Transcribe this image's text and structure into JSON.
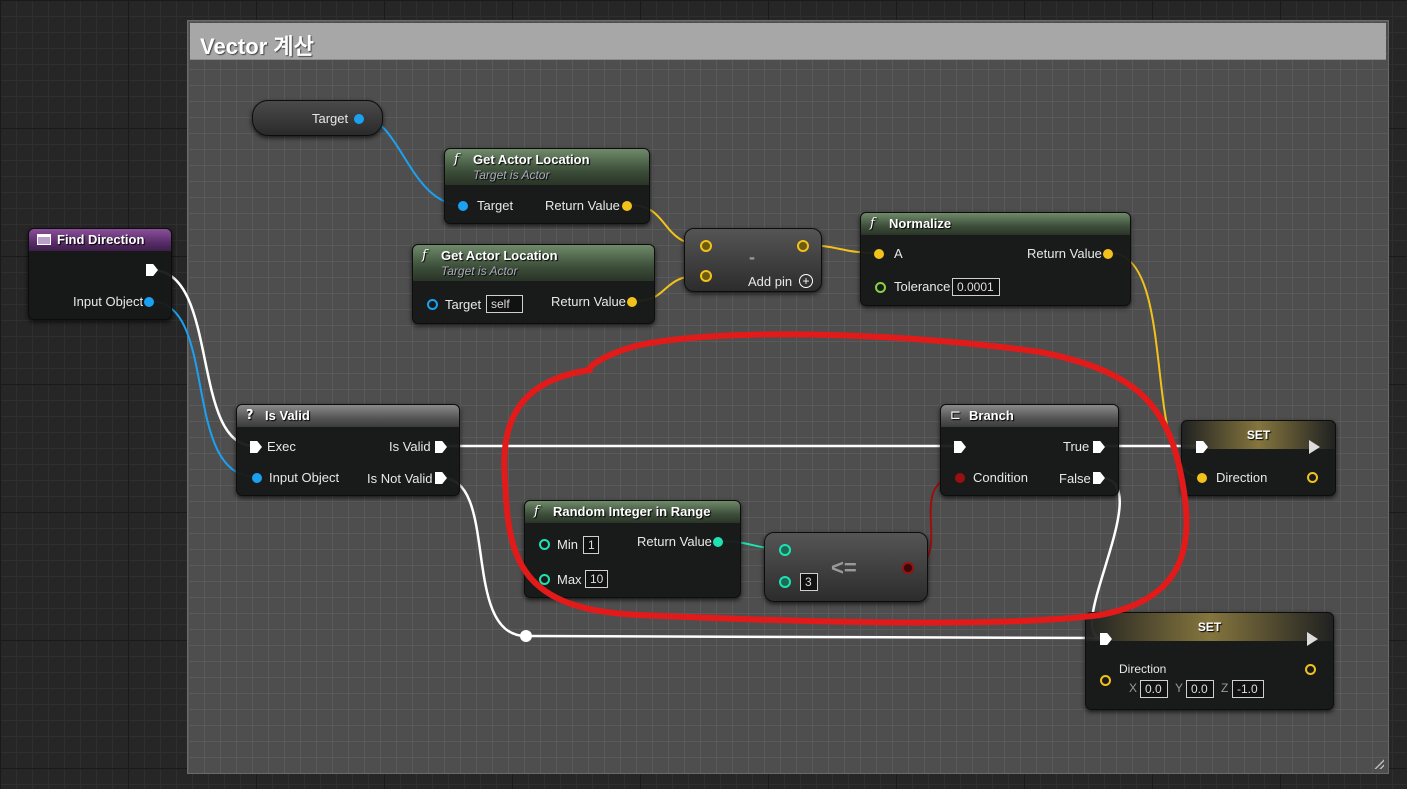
{
  "comment": {
    "title": "Vector 계산"
  },
  "nodes": {
    "target_var": {
      "label": "Target"
    },
    "get_loc1": {
      "title": "Get Actor Location",
      "subtitle": "Target is Actor",
      "in_pin": "Target",
      "out_pin": "Return Value"
    },
    "get_loc2": {
      "title": "Get Actor Location",
      "subtitle": "Target is Actor",
      "in_pin": "Target",
      "in_value": "self",
      "out_pin": "Return Value"
    },
    "subtract": {
      "symbol": "-",
      "add_pin": "Add pin"
    },
    "normalize": {
      "title": "Normalize",
      "pin_a": "A",
      "pin_tol": "Tolerance",
      "tol_value": "0.0001",
      "out_pin": "Return Value"
    },
    "find_direction": {
      "title": "Find Direction",
      "out_pin": "Input Object"
    },
    "is_valid": {
      "title": "Is Valid",
      "exec": "Exec",
      "input": "Input Object",
      "valid": "Is Valid",
      "not_valid": "Is Not Valid"
    },
    "branch": {
      "title": "Branch",
      "condition": "Condition",
      "true_pin": "True",
      "false_pin": "False"
    },
    "set1": {
      "title": "SET",
      "pin": "Direction"
    },
    "random": {
      "title": "Random Integer in Range",
      "min": "Min",
      "min_value": "1",
      "max": "Max",
      "max_value": "10",
      "out_pin": "Return Value"
    },
    "compare": {
      "symbol": "<=",
      "b_value": "3"
    },
    "set2": {
      "title": "SET",
      "pin": "Direction",
      "x_label": "X",
      "x": "0.0",
      "y_label": "Y",
      "y": "0.0",
      "z_label": "Z",
      "z": "-1.0"
    }
  },
  "colors": {
    "exec": "#ffffff",
    "object": "#1ba1f2",
    "vector": "#f2c21b",
    "integer": "#1ee3b0",
    "float": "#8ad13f",
    "bool": "#9a1010",
    "annotation": "#e31a1a"
  }
}
